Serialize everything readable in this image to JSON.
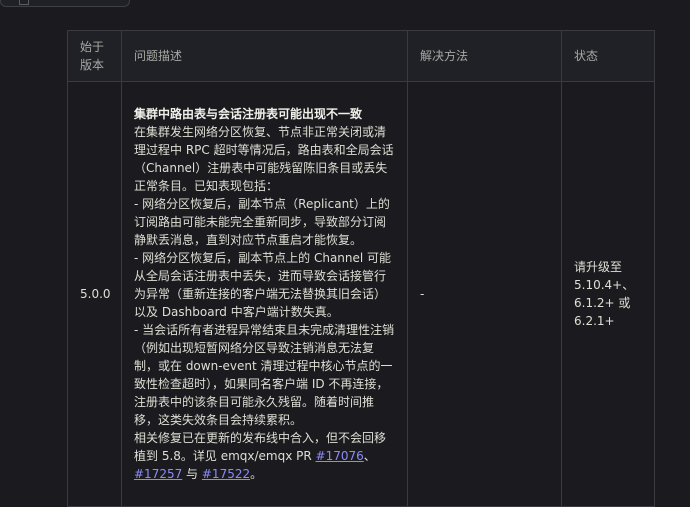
{
  "table": {
    "headers": {
      "since_version": "始于\n版本",
      "description": "问题描述",
      "workaround": "解决方法",
      "status": "状态"
    },
    "row": {
      "version": "5.0.0",
      "issue_title": "集群中路由表与会话注册表可能出现不一致",
      "paragraphs": [
        "在集群发生网络分区恢复、节点非正常关闭或清理过程中 RPC 超时等情况后，路由表和全局会话（Channel）注册表中可能残留陈旧条目或丢失正常条目。已知表现包括：",
        "- 网络分区恢复后，副本节点（Replicant）上的订阅路由可能未能完全重新同步，导致部分订阅静默丢消息，直到对应节点重启才能恢复。",
        "- 网络分区恢复后，副本节点上的 Channel 可能从全局会话注册表中丢失，进而导致会话接管行为异常（重新连接的客户端无法替换其旧会话）以及 Dashboard 中客户端计数失真。",
        "- 当会话所有者进程异常结束且未完成清理性注销（例如出现短暂网络分区导致注销消息无法复制，或在 down-event 清理过程中核心节点的一致性检查超时），如果同名客户端 ID 不再连接，注册表中的该条目可能永久残留。随着时间推移，这类失效条目会持续累积。"
      ],
      "fix_note_prefix": "相关修复已在更新的发布线中合入，但不会回移植到 5.8。详见 emqx/emqx PR ",
      "pr1": "#17076",
      "sep1": "、",
      "pr2": "#17257",
      "sep2": " 与 ",
      "pr3": "#17522",
      "end": "。",
      "workaround": "-",
      "status": "请升级至 5.10.4+、6.1.2+ 或 6.2.1+"
    }
  },
  "colors": {
    "background": "#1b1b1f",
    "header_bg": "#202127",
    "border": "#3a3b40",
    "link": "#8b8cf8"
  }
}
